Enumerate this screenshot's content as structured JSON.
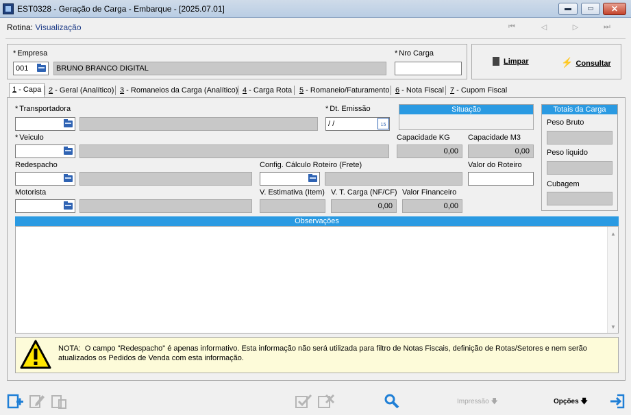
{
  "window": {
    "title": "EST0328 - Geração de Carga - Embarque - [2025.07.01]",
    "min": "▬",
    "max": "▭",
    "close": "✕"
  },
  "rotina": {
    "label": "Rotina:",
    "value": "Visualização"
  },
  "nav": {
    "first": "⏮",
    "prev": "◁",
    "next": "▷",
    "last": "⏭"
  },
  "header": {
    "empresa_label": "Empresa",
    "empresa_code": "001",
    "empresa_name": "BRUNO BRANCO DIGITAL",
    "nro_carga_label": "Nro Carga",
    "nro_carga_value": "",
    "limpar": "Limpar",
    "consultar": "Consultar"
  },
  "tabs": [
    {
      "key": "1",
      "label": " - Capa"
    },
    {
      "key": "2",
      "label": " - Geral (Analítico)"
    },
    {
      "key": "3",
      "label": " - Romaneios da Carga (Analítico)"
    },
    {
      "key": "4",
      "label": " - Carga Rota"
    },
    {
      "key": "5",
      "label": " - Romaneio/Faturamento"
    },
    {
      "key": "6",
      "label": " - Nota Fiscal"
    },
    {
      "key": "7",
      "label": " - Cupom Fiscal"
    }
  ],
  "form": {
    "transportadora": "Transportadora",
    "dt_emissao": "Dt. Emissão",
    "dt_emissao_value": " / /",
    "calendar_day": "15",
    "situacao": "Situação",
    "veiculo": "Veiculo",
    "capacidade_kg": "Capacidade KG",
    "capacidade_kg_value": "0,00",
    "capacidade_m3": "Capacidade M3",
    "capacidade_m3_value": "0,00",
    "redespacho": "Redespacho",
    "config_calculo": "Config. Cálculo Roteiro (Frete)",
    "valor_roteiro": "Valor do Roteiro",
    "motorista": "Motorista",
    "v_estimativa": "V. Estimativa (Item)",
    "v_t_carga": "V. T. Carga (NF/CF)",
    "v_t_carga_value": "0,00",
    "valor_financeiro": "Valor Financeiro",
    "valor_financeiro_value": "0,00"
  },
  "totais": {
    "title": "Totais da Carga",
    "peso_bruto": "Peso Bruto",
    "peso_liquido": "Peso liquido",
    "cubagem": "Cubagem"
  },
  "observacoes": {
    "title": "Observações"
  },
  "note": {
    "prefix": "NOTA:",
    "text": "O campo \"Redespacho\" é apenas informativo. Esta informação não será utilizada para filtro de Notas Fiscais, definição de Rotas/Setores e nem serão atualizados os Pedidos de Venda com esta informação."
  },
  "bottom": {
    "impressao": "Impressão",
    "opcoes": "Opções",
    "down_arrow": "🡇"
  },
  "colors": {
    "accent": "#2a9ae2",
    "brand": "#1e3c87",
    "note_bg": "#fdfbd9"
  }
}
